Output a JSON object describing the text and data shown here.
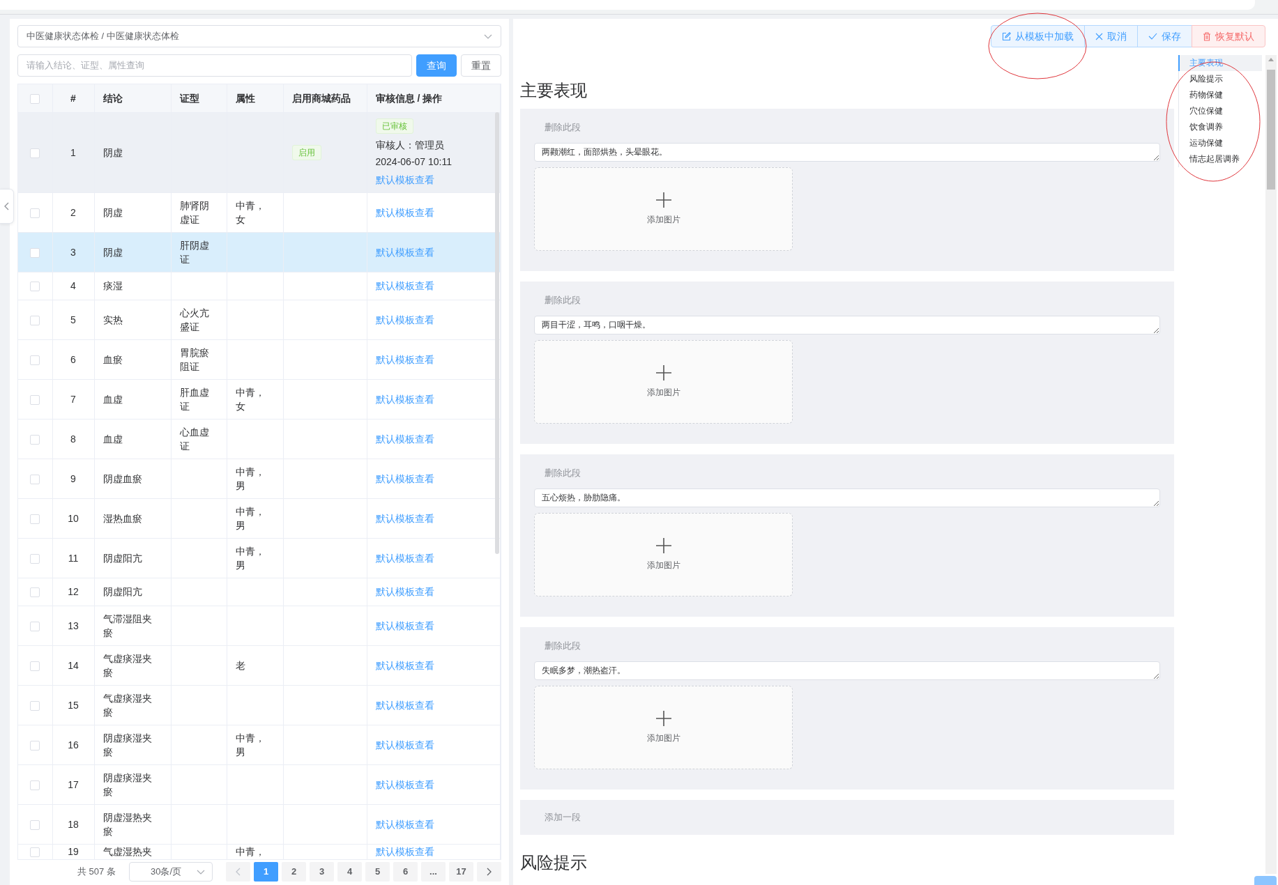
{
  "category_select": {
    "value": "中医健康状态体检 / 中医健康状态体检"
  },
  "search": {
    "placeholder": "请输入结论、证型、属性查询"
  },
  "search_buttons": [
    {
      "label": "查询",
      "kind": "primary"
    },
    {
      "label": "重置",
      "kind": "default"
    }
  ],
  "table": {
    "header_checked": false,
    "columns": [
      "#",
      "结论",
      "证型",
      "属性",
      "启用商城药品",
      "审核信息 / 操作"
    ],
    "rows": [
      {
        "index": "1",
        "conclusion": "阴虚",
        "mall_tag": "启用",
        "audit": {
          "status": "已审核",
          "reviewer": "审核人：管理员",
          "time": "2024-06-07 10:11"
        },
        "action": "默认模板查看",
        "checked": false,
        "selected": false,
        "hovered": true
      },
      {
        "index": "2",
        "conclusion": "阴虚",
        "syndrome": "肺肾阴虚证",
        "attribute": "中青，女",
        "action": "默认模板查看",
        "checked": false,
        "selected": false,
        "hovered": false
      },
      {
        "index": "3",
        "conclusion": "阴虚",
        "syndrome": "肝阴虚证",
        "action": "默认模板查看",
        "checked": false,
        "selected": true,
        "hovered": false
      },
      {
        "index": "4",
        "conclusion": "痰湿",
        "action": "默认模板查看",
        "checked": false,
        "selected": false,
        "hovered": false
      },
      {
        "index": "5",
        "conclusion": "实热",
        "syndrome": "心火亢盛证",
        "action": "默认模板查看",
        "checked": false,
        "selected": false,
        "hovered": false
      },
      {
        "index": "6",
        "conclusion": "血瘀",
        "syndrome": "胃脘瘀阻证",
        "action": "默认模板查看",
        "checked": false,
        "selected": false,
        "hovered": false
      },
      {
        "index": "7",
        "conclusion": "血虚",
        "syndrome": "肝血虚证",
        "attribute": "中青，女",
        "action": "默认模板查看",
        "checked": false,
        "selected": false,
        "hovered": false
      },
      {
        "index": "8",
        "conclusion": "血虚",
        "syndrome": "心血虚证",
        "action": "默认模板查看",
        "checked": false,
        "selected": false,
        "hovered": false
      },
      {
        "index": "9",
        "conclusion": "阴虚血瘀",
        "attribute": "中青，男",
        "action": "默认模板查看",
        "checked": false,
        "selected": false,
        "hovered": false
      },
      {
        "index": "10",
        "conclusion": "湿热血瘀",
        "attribute": "中青，男",
        "action": "默认模板查看",
        "checked": false,
        "selected": false,
        "hovered": false
      },
      {
        "index": "11",
        "conclusion": "阴虚阳亢",
        "attribute": "中青，男",
        "action": "默认模板查看",
        "checked": false,
        "selected": false,
        "hovered": false
      },
      {
        "index": "12",
        "conclusion": "阴虚阳亢",
        "action": "默认模板查看",
        "checked": false,
        "selected": false,
        "hovered": false
      },
      {
        "index": "13",
        "conclusion": "气滞湿阻夹瘀",
        "action": "默认模板查看",
        "checked": false,
        "selected": false,
        "hovered": false
      },
      {
        "index": "14",
        "conclusion": "气虚痰湿夹瘀",
        "attribute": "老",
        "action": "默认模板查看",
        "checked": false,
        "selected": false,
        "hovered": false
      },
      {
        "index": "15",
        "conclusion": "气虚痰湿夹瘀",
        "action": "默认模板查看",
        "checked": false,
        "selected": false,
        "hovered": false
      },
      {
        "index": "16",
        "conclusion": "阴虚痰湿夹瘀",
        "attribute": "中青，男",
        "action": "默认模板查看",
        "checked": false,
        "selected": false,
        "hovered": false
      },
      {
        "index": "17",
        "conclusion": "阴虚痰湿夹瘀",
        "action": "默认模板查看",
        "checked": false,
        "selected": false,
        "hovered": false
      },
      {
        "index": "18",
        "conclusion": "阴虚湿热夹瘀",
        "action": "默认模板查看",
        "checked": false,
        "selected": false,
        "hovered": false
      },
      {
        "index": "19",
        "conclusion": "气虚湿热夹",
        "attribute": "中青，",
        "action": "默认模板查看",
        "checked": false,
        "selected": false,
        "hovered": false
      }
    ]
  },
  "pagination": {
    "total": "共 507 条",
    "page_size": "30条/页",
    "pages": [
      {
        "label": "1",
        "selected": true
      },
      {
        "label": "2",
        "selected": false
      },
      {
        "label": "3",
        "selected": false
      },
      {
        "label": "4",
        "selected": false
      },
      {
        "label": "5",
        "selected": false
      },
      {
        "label": "6",
        "selected": false
      },
      {
        "label": "...",
        "selected": false
      },
      {
        "label": "17",
        "selected": false
      }
    ]
  },
  "toolbar": [
    {
      "label": "从模板中加载",
      "kind": "primary"
    },
    {
      "label": "取消",
      "kind": "primary"
    },
    {
      "label": "保存",
      "kind": "primary"
    },
    {
      "label": "恢复默认",
      "kind": "danger"
    }
  ],
  "sections": [
    {
      "title": "主要表现",
      "paragraphs": [
        {
          "delete_label": "删除此段",
          "text": "两颧潮红，面部烘热，头晕眼花。",
          "upload_label": "添加图片"
        },
        {
          "delete_label": "删除此段",
          "text": "两目干涩，耳鸣，口咽干燥。",
          "upload_label": "添加图片"
        },
        {
          "delete_label": "删除此段",
          "text": "五心烦热，胁肋隐痛。",
          "upload_label": "添加图片"
        },
        {
          "delete_label": "删除此段",
          "text": "失眠多梦，潮热盗汗。",
          "upload_label": "添加图片"
        }
      ],
      "add_label": "添加一段"
    },
    {
      "title": "风险提示"
    }
  ],
  "toc": [
    {
      "label": "主要表现",
      "selected": true
    },
    {
      "label": "风险提示",
      "selected": false
    },
    {
      "label": "药物保健",
      "selected": false
    },
    {
      "label": "穴位保健",
      "selected": false
    },
    {
      "label": "饮食调养",
      "selected": false
    },
    {
      "label": "运动保健",
      "selected": false
    },
    {
      "label": "情志起居调养",
      "selected": false
    }
  ]
}
